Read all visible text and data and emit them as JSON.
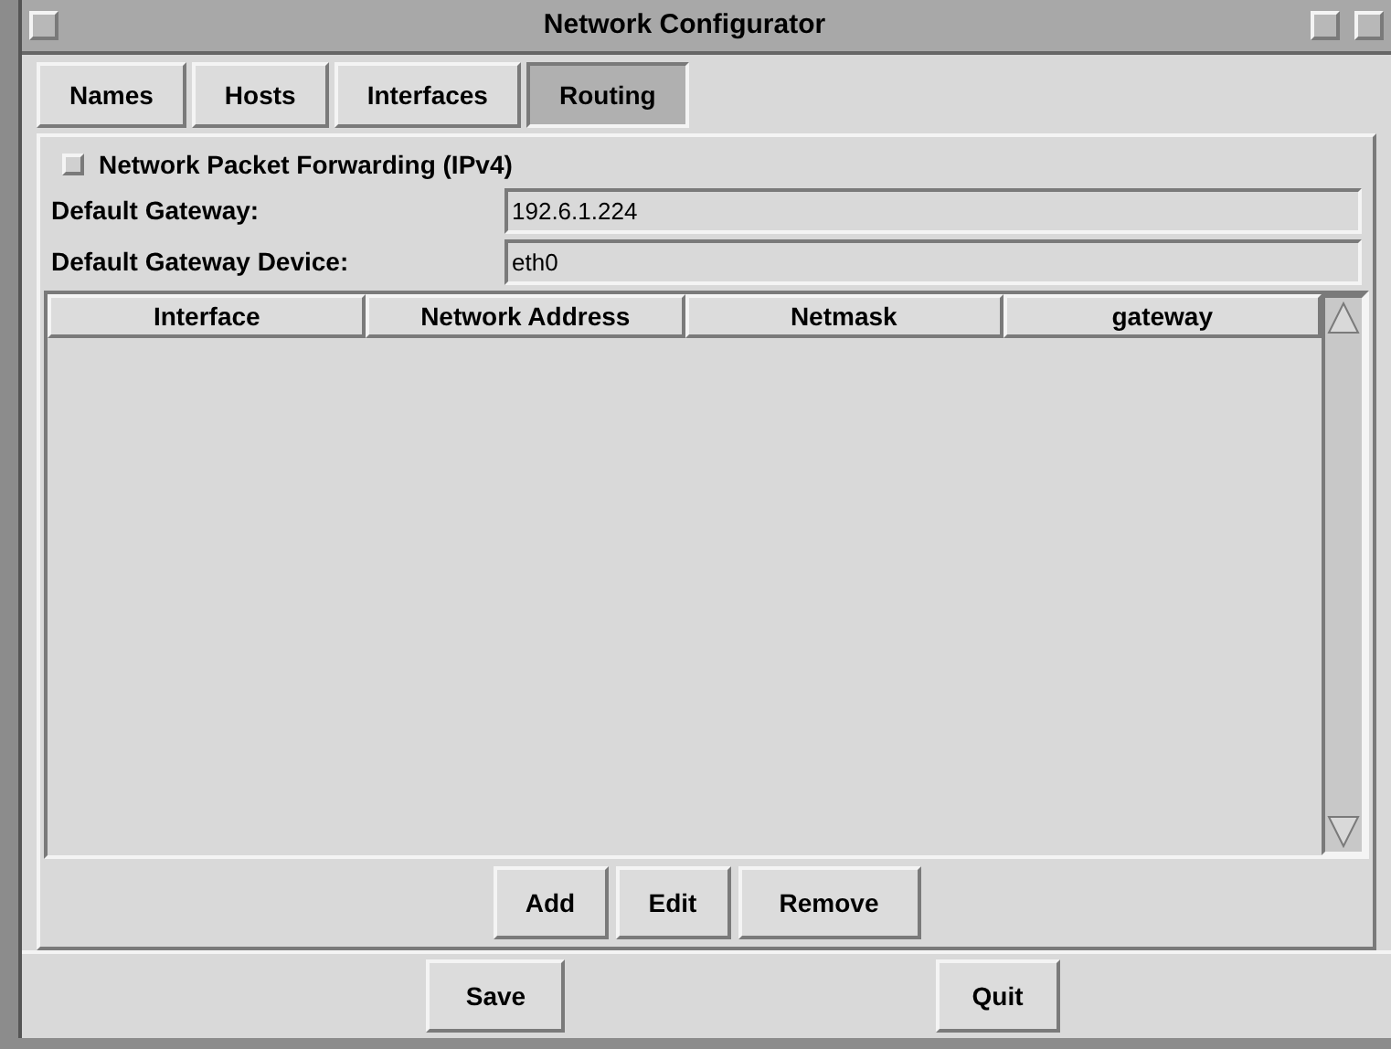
{
  "window": {
    "title": "Network Configurator"
  },
  "tabs": [
    {
      "label": "Names",
      "selected": false
    },
    {
      "label": "Hosts",
      "selected": false
    },
    {
      "label": "Interfaces",
      "selected": false
    },
    {
      "label": "Routing",
      "selected": true
    }
  ],
  "forwarding": {
    "label": "Network Packet Forwarding (IPv4)",
    "checked": false
  },
  "fields": [
    {
      "label": "Default Gateway:",
      "value": "192.6.1.224"
    },
    {
      "label": "Default Gateway Device:",
      "value": "eth0"
    }
  ],
  "table": {
    "columns": [
      "Interface",
      "Network Address",
      "Netmask",
      "gateway"
    ]
  },
  "table_buttons": [
    "Add",
    "Edit",
    "Remove"
  ],
  "bottom_buttons": [
    "Save",
    "Quit"
  ]
}
